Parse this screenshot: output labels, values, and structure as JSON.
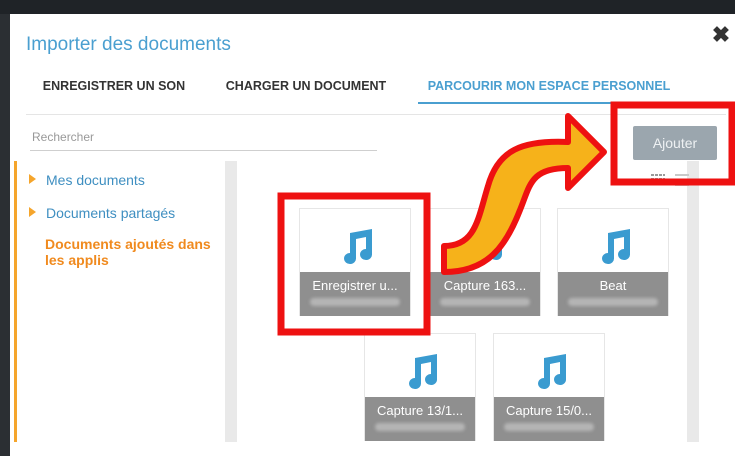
{
  "dialog": {
    "title": "Importer des documents",
    "close_icon": "close-icon"
  },
  "tabs": [
    {
      "label": "ENREGISTRER UN SON"
    },
    {
      "label": "CHARGER UN DOCUMENT"
    },
    {
      "label": "PARCOURIR MON ESPACE PERSONNEL",
      "active": true
    }
  ],
  "search": {
    "placeholder": "Rechercher",
    "value": ""
  },
  "add_button": {
    "label": "Ajouter",
    "enabled": false
  },
  "sidebar": {
    "items": [
      {
        "label": "Mes documents",
        "icon": "caret-right-icon"
      },
      {
        "label": "Documents partagés",
        "icon": "caret-right-icon"
      },
      {
        "label": "Documents ajoutés dans les applis",
        "selected": true
      }
    ]
  },
  "view_toggle": {
    "grid_icon": "grid-view-icon",
    "list_icon": "list-view-icon"
  },
  "files": [
    {
      "name": "Enregistrer u...",
      "icon": "music-note-icon",
      "highlighted": true
    },
    {
      "name": "Capture 163...",
      "icon": "music-note-icon"
    },
    {
      "name": "Beat",
      "icon": "music-note-icon"
    },
    {
      "name": "Capture 13/1...",
      "icon": "music-note-icon"
    },
    {
      "name": "Capture 15/0...",
      "icon": "music-note-icon"
    }
  ],
  "colors": {
    "accent_blue": "#4a9fd0",
    "accent_orange": "#f5a52c",
    "annotation_red": "#ee1111",
    "arrow_fill": "#f6b21a",
    "note_blue": "#3a9bd0",
    "caption_gray": "#8f8f8f"
  }
}
